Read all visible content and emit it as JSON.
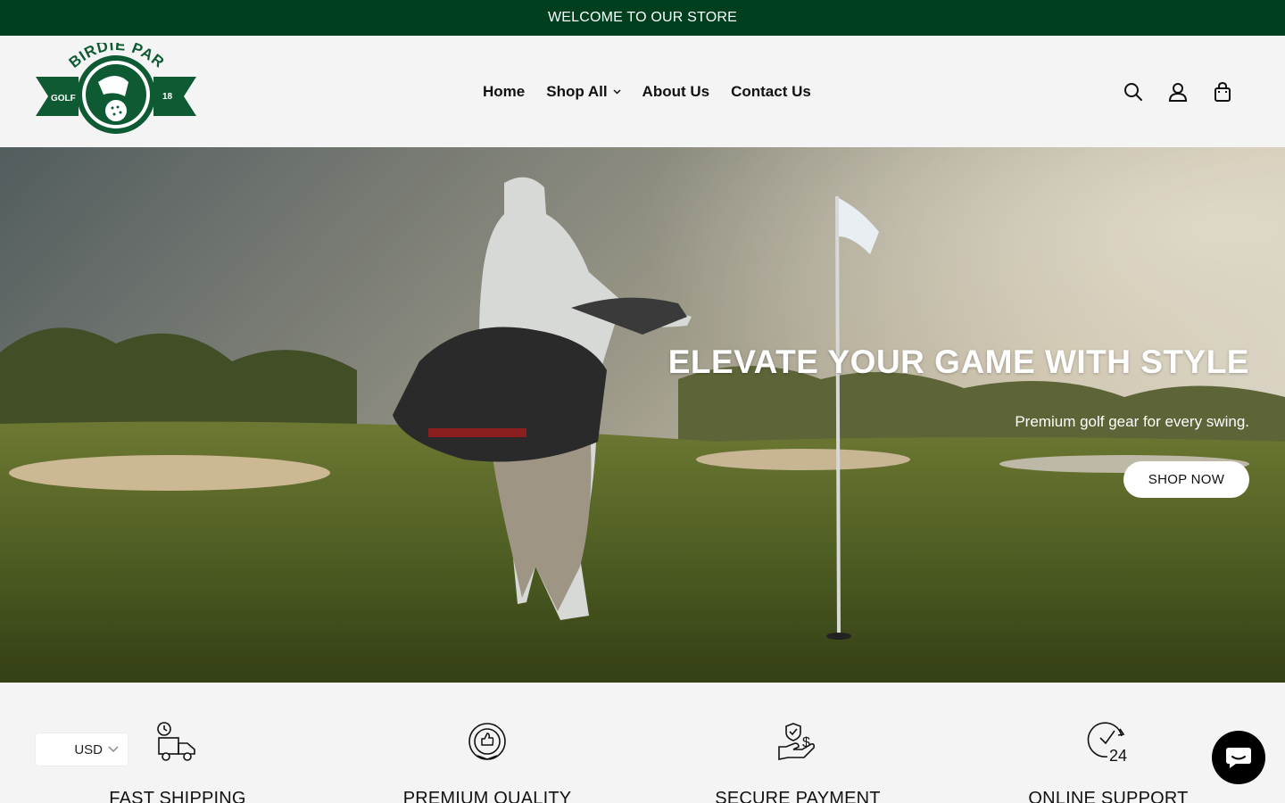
{
  "announcement": {
    "text": "WELCOME TO OUR STORE"
  },
  "logo": {
    "brand": "BIRDIE PAR",
    "left_text": "GOLF",
    "right_text": "18",
    "color": "#0d5a33"
  },
  "nav": {
    "items": [
      {
        "label": "Home"
      },
      {
        "label": "Shop All",
        "has_dropdown": true
      },
      {
        "label": "About Us"
      },
      {
        "label": "Contact Us"
      }
    ]
  },
  "header_icons": [
    "search-icon",
    "account-icon",
    "cart-icon"
  ],
  "hero": {
    "title": "ELEVATE YOUR GAME WITH STYLE",
    "subtitle": "Premium golf gear for every swing.",
    "button_label": "SHOP NOW"
  },
  "features": [
    {
      "label": "FAST SHIPPING",
      "icon": "delivery-truck-icon"
    },
    {
      "label": "PREMIUM QUALITY",
      "icon": "quality-badge-icon"
    },
    {
      "label": "SECURE PAYMENT",
      "icon": "secure-payment-icon"
    },
    {
      "label": "ONLINE SUPPORT",
      "icon": "support-24-icon"
    }
  ],
  "currency": {
    "value": "USD"
  },
  "chat": {
    "icon": "chat-icon"
  },
  "colors": {
    "announcement_bg": "#003f1e",
    "brand_green": "#0d5a33",
    "page_bg": "#f4f4f4"
  }
}
